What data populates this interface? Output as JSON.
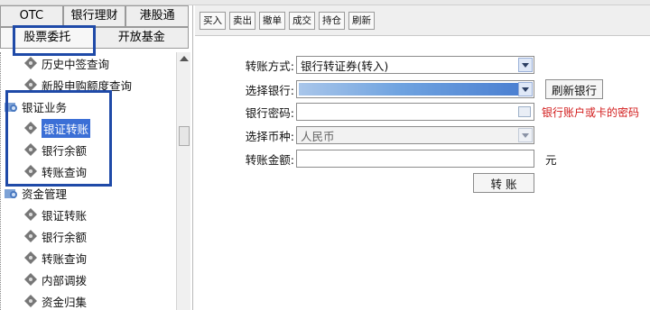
{
  "left_panel": {
    "tabs_row1": [
      "OTC",
      "银行理财",
      "港股通"
    ],
    "tabs_row2": [
      "股票委托",
      "开放基金"
    ],
    "tree": [
      {
        "label": "历史中签查询",
        "level": "child"
      },
      {
        "label": "新股申购额度查询",
        "level": "child"
      },
      {
        "label": "银证业务",
        "level": "top"
      },
      {
        "label": "银证转账",
        "level": "child",
        "selected": true
      },
      {
        "label": "银行余额",
        "level": "child"
      },
      {
        "label": "转账查询",
        "level": "child"
      },
      {
        "label": "资金管理",
        "level": "top"
      },
      {
        "label": "银证转账",
        "level": "child"
      },
      {
        "label": "银行余额",
        "level": "child"
      },
      {
        "label": "转账查询",
        "level": "child"
      },
      {
        "label": "内部调拨",
        "level": "child"
      },
      {
        "label": "资金归集",
        "level": "child"
      }
    ]
  },
  "toolbar": {
    "buttons": [
      "买入",
      "卖出",
      "撤单",
      "成交",
      "持仓",
      "刷新"
    ]
  },
  "form": {
    "transfer_mode_label": "转账方式:",
    "transfer_mode_value": "银行转证券(转入)",
    "bank_label": "选择银行:",
    "refresh_bank_button": "刷新银行",
    "bank_password_label": "银行密码:",
    "bank_password_hint": "银行账户或卡的密码",
    "currency_label": "选择币种:",
    "currency_value": "人民币",
    "amount_label": "转账金额:",
    "amount_unit": "元",
    "submit_button": "转 账"
  },
  "colors": {
    "highlight_box": "#1f4aa8",
    "selection": "#3b6fd6",
    "hint_red": "#d21b1b"
  },
  "icons": {
    "bank_folder": "bank-folder-icon",
    "tree_leaf": "diamond-tool-icon",
    "dropdown": "chevron-down-icon",
    "keyboard": "keyboard-icon",
    "scroll_up": "scroll-up-icon"
  }
}
